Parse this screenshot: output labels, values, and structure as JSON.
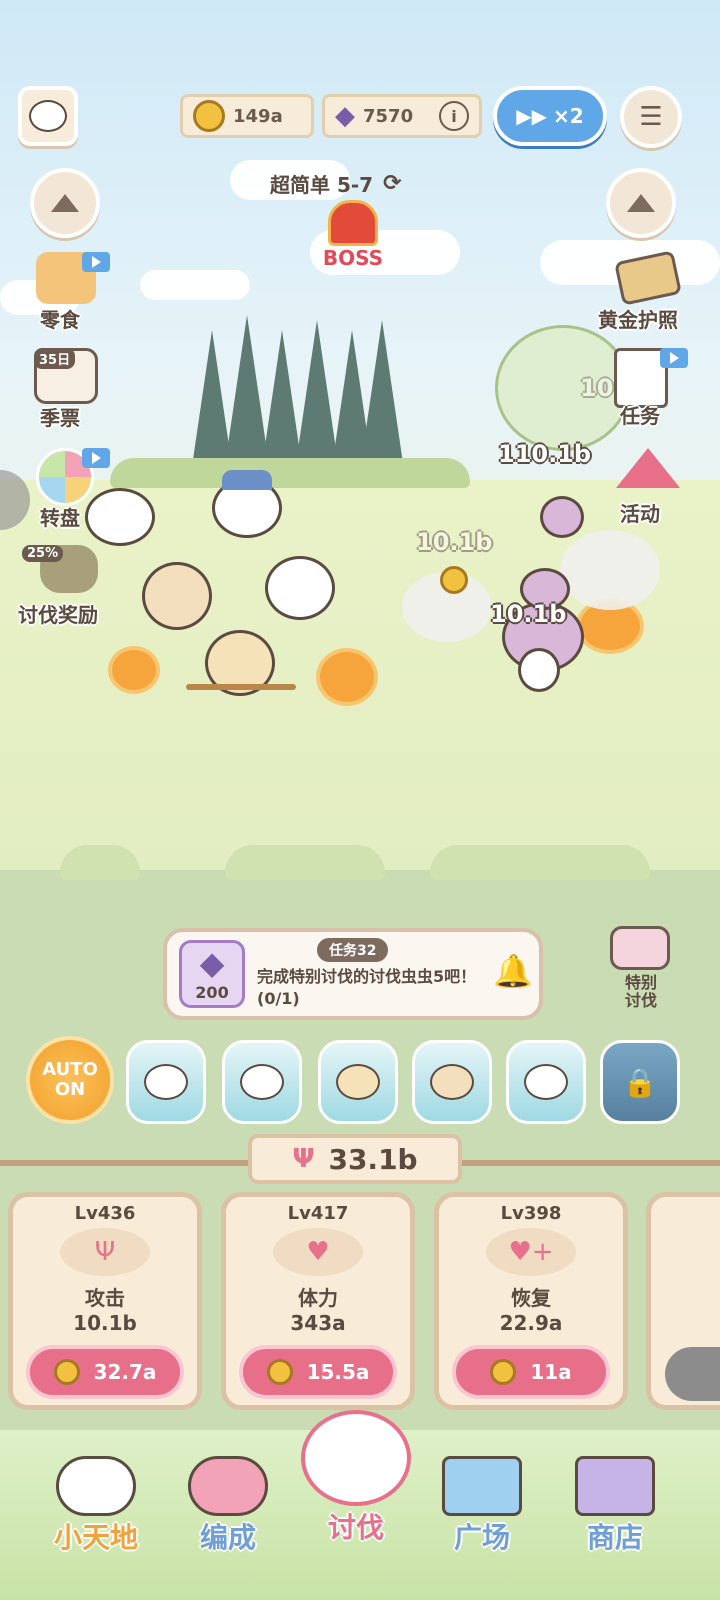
{
  "top_bar": {
    "coins": "149a",
    "gems": "7570",
    "speed": "×2"
  },
  "stage": {
    "label": "超简单 5-7",
    "boss_label": "BOSS"
  },
  "left_menu": [
    {
      "label": "零食"
    },
    {
      "label": "季票",
      "badge": "35日"
    },
    {
      "label": "转盘"
    },
    {
      "label": "讨伐奖励",
      "badge": "25%"
    }
  ],
  "right_menu": [
    {
      "label": "黄金护照"
    },
    {
      "label": "任务"
    },
    {
      "label": "活动"
    }
  ],
  "battle": {
    "damage_texts": [
      "110.1b",
      "10.1b",
      "10.1b",
      "10",
      "10"
    ]
  },
  "quest": {
    "title": "任务32",
    "description": "完成特别讨伐的讨伐虫虫5吧！(0/1)",
    "reward": "200"
  },
  "special_hunt": {
    "label": "特别\n讨伐"
  },
  "auto_button": {
    "line1": "AUTO",
    "line2": "ON"
  },
  "power_total": "33.1b",
  "upgrades": [
    {
      "level": "Lv436",
      "name": "攻击",
      "value": "10.1b",
      "cost": "32.7a"
    },
    {
      "level": "Lv417",
      "name": "体力",
      "value": "343a",
      "cost": "15.5a"
    },
    {
      "level": "Lv398",
      "name": "恢复",
      "value": "22.9a",
      "cost": "11a"
    }
  ],
  "nav": [
    {
      "label": "小天地",
      "color": "#f0a23b"
    },
    {
      "label": "编成",
      "color": "#6f9fd6"
    },
    {
      "label": "讨伐",
      "color": "#e8708a"
    },
    {
      "label": "广场",
      "color": "#6f9fd6"
    },
    {
      "label": "商店",
      "color": "#6f9fd6"
    }
  ]
}
